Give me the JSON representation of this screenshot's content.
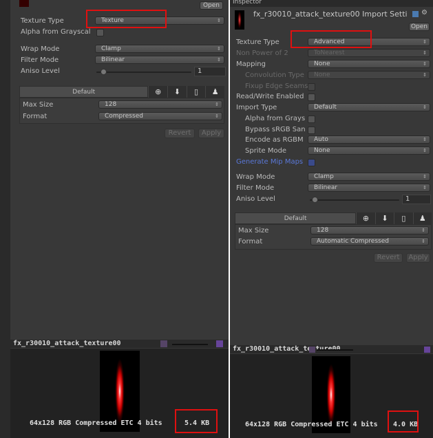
{
  "left": {
    "open_label": "Open",
    "rows": {
      "texture_type": {
        "label": "Texture Type",
        "value": "Texture"
      },
      "alpha_from_grayscale": {
        "label": "Alpha from Grayscal",
        "checked": false
      },
      "wrap_mode": {
        "label": "Wrap Mode",
        "value": "Clamp"
      },
      "filter_mode": {
        "label": "Filter Mode",
        "value": "Bilinear"
      },
      "aniso_level": {
        "label": "Aniso Level",
        "value": "1"
      }
    },
    "platform_tabs": {
      "default": "Default",
      "icons": [
        "globe-icon",
        "download-icon",
        "phone-icon",
        "android-icon"
      ]
    },
    "max_size": {
      "label": "Max Size",
      "value": "128"
    },
    "format": {
      "label": "Format",
      "value": "Compressed"
    },
    "revert_label": "Revert",
    "apply_label": "Apply",
    "preview": {
      "name": "fx_r30010_attack_texture00",
      "info": "64x128  RGB Compressed ETC 4 bits",
      "size": "5.4 KB"
    }
  },
  "right": {
    "tab_title": "Inspector",
    "asset_title": "fx_r30010_attack_texture00 Import Setti",
    "open_label": "Open",
    "rows": {
      "texture_type": {
        "label": "Texture Type",
        "value": "Advanced"
      },
      "non_power_of_2": {
        "label": "Non Power of 2",
        "value": "ToNearest"
      },
      "mapping": {
        "label": "Mapping",
        "value": "None"
      },
      "convolution_type": {
        "label": "Convolution Type",
        "value": "None"
      },
      "fixup_edge_seams": {
        "label": "Fixup Edge Seams",
        "checked": false
      },
      "read_write": {
        "label": "Read/Write Enabled",
        "checked": false
      },
      "import_type": {
        "label": "Import Type",
        "value": "Default"
      },
      "alpha_from_grayscale": {
        "label": "Alpha from Grays",
        "checked": false
      },
      "bypass_srgb": {
        "label": "Bypass sRGB San",
        "checked": false
      },
      "encode_rgbm": {
        "label": "Encode as RGBM",
        "value": "Auto"
      },
      "sprite_mode": {
        "label": "Sprite Mode",
        "value": "None"
      },
      "generate_mip_maps": {
        "label": "Generate Mip Maps",
        "checked": false
      },
      "wrap_mode": {
        "label": "Wrap Mode",
        "value": "Clamp"
      },
      "filter_mode": {
        "label": "Filter Mode",
        "value": "Bilinear"
      },
      "aniso_level": {
        "label": "Aniso Level",
        "value": "1"
      }
    },
    "platform_tabs": {
      "default": "Default"
    },
    "max_size": {
      "label": "Max Size",
      "value": "128"
    },
    "format": {
      "label": "Format",
      "value": "Automatic Compressed"
    },
    "revert_label": "Revert",
    "apply_label": "Apply",
    "preview": {
      "name": "fx_r30010_attack_texture00",
      "info": "64x128  RGB Compressed ETC 4 bits",
      "size": "4.0 KB"
    }
  },
  "colors": {
    "highlight": "#e01010",
    "link_label": "#5a78d8"
  }
}
